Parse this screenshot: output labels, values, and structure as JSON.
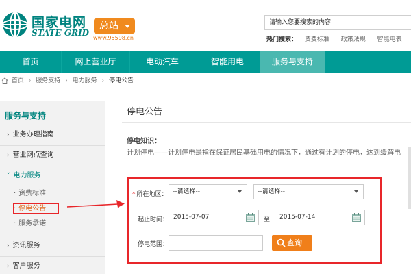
{
  "header": {
    "logo_cn": "国家电网",
    "logo_en": "STATE GRID",
    "site_button": "总站",
    "site_url": "www.95598.cn",
    "search_placeholder": "请输入您要搜索的内容",
    "hot_label": "热门搜索：",
    "hot_links": [
      "资费标准",
      "政策法规",
      "智能电表"
    ]
  },
  "nav": {
    "items": [
      "首页",
      "网上营业厅",
      "电动汽车",
      "智能用电",
      "服务与支持"
    ],
    "active": "服务与支持"
  },
  "breadcrumb": {
    "items": [
      "首页",
      "服务支持",
      "电力服务",
      "停电公告"
    ]
  },
  "sidebar": {
    "title": "服务与支持",
    "items": [
      "业务办理指南",
      "营业网点查询",
      "电力服务",
      "资讯服务",
      "客户服务"
    ],
    "subitems": [
      "资费标准",
      "停电公告",
      "服务承诺"
    ],
    "active_subitem": "停电公告"
  },
  "main": {
    "title": "停电公告",
    "knowledge_title": "停电知识：",
    "knowledge_text": "计划停电——计划停电是指在保证居民基础用电的情况下，通过有计划的停电，达到缓解电",
    "form": {
      "region_label": "所在地区：",
      "region_select_1": "--请选择--",
      "region_select_2": "--请选择--",
      "time_label": "起止时间：",
      "start_date": "2015-07-07",
      "to_label": "至",
      "end_date": "2015-07-14",
      "range_label": "停电范围：",
      "range_value": "",
      "query_button": "查询"
    }
  },
  "colors": {
    "brand_teal": "#009b95",
    "nav_active": "#4ab8b0",
    "orange": "#f08a1e",
    "highlight_red": "#e8262a"
  },
  "icons": [
    "state-grid-logo-icon",
    "home-icon",
    "chevron-right-icon",
    "calendar-icon",
    "search-icon"
  ]
}
